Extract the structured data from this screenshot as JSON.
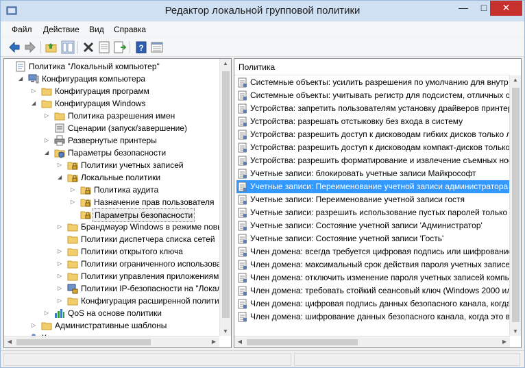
{
  "window": {
    "title": "Редактор локальной групповой политики",
    "minimize": "—",
    "maximize": "□",
    "close": "✕"
  },
  "menu": [
    "Файл",
    "Действие",
    "Вид",
    "Справка"
  ],
  "toolbar": {
    "icons": [
      "back-arrow-icon",
      "forward-arrow-icon",
      "up-folder-icon",
      "show-hide-tree-icon",
      "delete-icon",
      "properties-icon",
      "export-list-icon",
      "help-icon",
      "extended-view-icon"
    ]
  },
  "tree": [
    {
      "label": "Политика \"Локальный компьютер\"",
      "indent": 0,
      "arrow": "",
      "icon": "computer-policy-icon"
    },
    {
      "label": "Конфигурация компьютера",
      "indent": 1,
      "arrow": "open",
      "icon": "computer-icon"
    },
    {
      "label": "Конфигурация программ",
      "indent": 2,
      "arrow": "closed",
      "icon": "folder-icon"
    },
    {
      "label": "Конфигурация Windows",
      "indent": 2,
      "arrow": "open",
      "icon": "folder-icon"
    },
    {
      "label": "Политика разрешения имен",
      "indent": 3,
      "arrow": "closed",
      "icon": "folder-icon"
    },
    {
      "label": "Сценарии (запуск/завершение)",
      "indent": 3,
      "arrow": "",
      "icon": "script-icon"
    },
    {
      "label": "Развернутые принтеры",
      "indent": 3,
      "arrow": "closed",
      "icon": "printer-icon"
    },
    {
      "label": "Параметры безопасности",
      "indent": 3,
      "arrow": "open",
      "icon": "security-settings-icon"
    },
    {
      "label": "Политики учетных записей",
      "indent": 4,
      "arrow": "closed",
      "icon": "lock-folder-icon"
    },
    {
      "label": "Локальные политики",
      "indent": 4,
      "arrow": "open",
      "icon": "lock-folder-icon"
    },
    {
      "label": "Политика аудита",
      "indent": 5,
      "arrow": "closed",
      "icon": "lock-folder-icon"
    },
    {
      "label": "Назначение прав пользователя",
      "indent": 5,
      "arrow": "closed",
      "icon": "lock-folder-icon"
    },
    {
      "label": "Параметры безопасности",
      "indent": 5,
      "arrow": "",
      "icon": "lock-folder-icon",
      "selected": true
    },
    {
      "label": "Брандмауэр Windows в режиме повы",
      "indent": 4,
      "arrow": "closed",
      "icon": "folder-icon"
    },
    {
      "label": "Политики диспетчера списка сетей",
      "indent": 4,
      "arrow": "",
      "icon": "folder-icon"
    },
    {
      "label": "Политики открытого ключа",
      "indent": 4,
      "arrow": "closed",
      "icon": "folder-icon"
    },
    {
      "label": "Политики ограниченного использова",
      "indent": 4,
      "arrow": "closed",
      "icon": "folder-icon"
    },
    {
      "label": "Политики управления приложениями",
      "indent": 4,
      "arrow": "closed",
      "icon": "folder-icon"
    },
    {
      "label": "Политики IP-безопасности на \"Локал",
      "indent": 4,
      "arrow": "closed",
      "icon": "ip-security-icon"
    },
    {
      "label": "Конфигурация расширенной полити",
      "indent": 4,
      "arrow": "closed",
      "icon": "folder-icon"
    },
    {
      "label": "QoS на основе политики",
      "indent": 3,
      "arrow": "closed",
      "icon": "qos-chart-icon"
    },
    {
      "label": "Административные шаблоны",
      "indent": 2,
      "arrow": "closed",
      "icon": "folder-icon"
    },
    {
      "label": "К",
      "indent": 1,
      "arrow": "closed",
      "icon": "user-icon"
    }
  ],
  "list": {
    "header": "Политика",
    "rows": [
      "Системные объекты: усилить разрешения по умолчанию для внутр",
      "Системные объекты: учитывать регистр для подсистем, отличных о",
      "Устройства: запретить пользователям установку драйверов принтер",
      "Устройства: разрешать отстыковку без входа в систему",
      "Устройства: разрешить доступ к дисководам гибких дисков только л",
      "Устройства: разрешить доступ к дисководам компакт-дисков только",
      "Устройства: разрешить форматирование и извлечение съемных нос",
      "Учетные записи: блокировать учетные записи Майкрософт",
      "Учетные записи: Переименование учетной записи администратора",
      "Учетные записи: Переименование учетной записи гостя",
      "Учетные записи: разрешить использование пустых паролей только",
      "Учетные записи: Состояние учетной записи 'Администратор'",
      "Учетные записи: Состояние учетной записи 'Гость'",
      "Член домена: всегда требуется цифровая подпись или шифрование",
      "Член домена: максимальный срок действия пароля учетных записе",
      "Член домена: отключить изменение пароля учетных записей компь",
      "Член домена: требовать стойкий сеансовый ключ (Windows 2000 ил",
      "Член домена: цифровая подпись данных безопасного канала, когда",
      "Член домена: шифрование данных безопасного канала, когда это в"
    ],
    "selected_index": 8
  },
  "colors": {
    "selection": "#3399ff",
    "titlebar": "#cfe0f3",
    "close_button": "#c7312d"
  }
}
